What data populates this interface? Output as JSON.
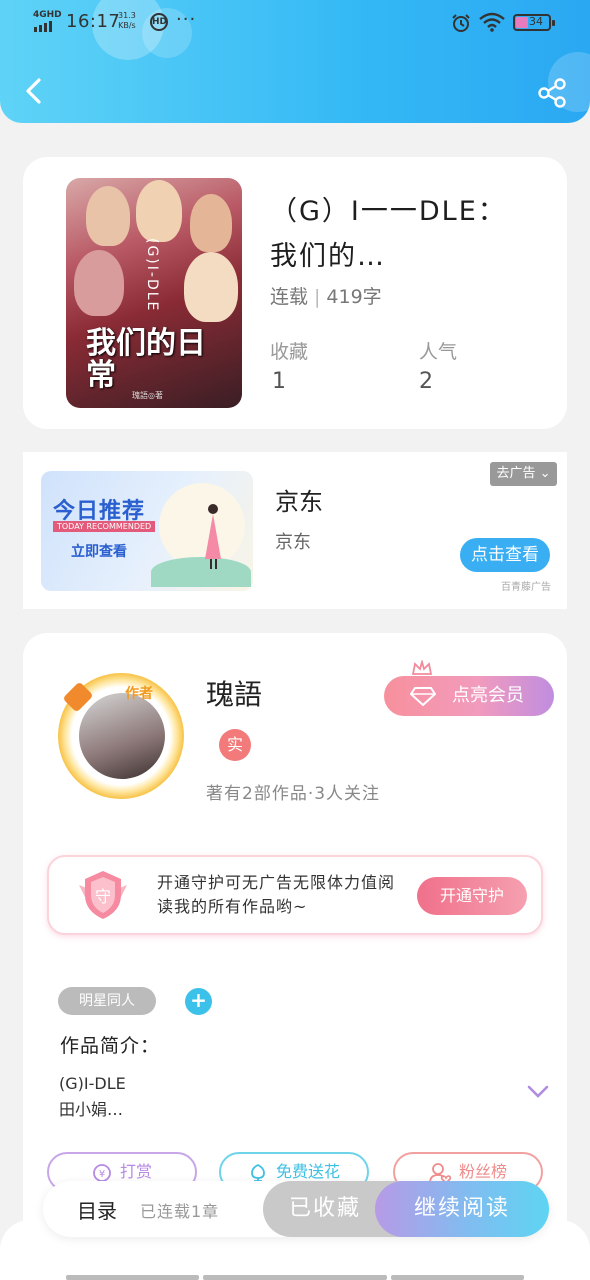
{
  "status_bar": {
    "network": "4GHD",
    "time": "16:17",
    "speed_value": "31.3",
    "speed_unit": "KB/s",
    "hd_badge": "HD",
    "dots": "···",
    "battery": "34"
  },
  "header": {
    "back_icon": "chevron-left-icon",
    "share_icon": "share-icon"
  },
  "book": {
    "cover_title": "我们的日常",
    "cover_subtitle": "(G)I-DLE",
    "cover_author": "瑰語◎著",
    "title": "（G）I一一DLE：我们的…",
    "status": "连载",
    "word_count": "419字",
    "favorites_label": "收藏",
    "favorites_value": "1",
    "popularity_label": "人气",
    "popularity_value": "2"
  },
  "ad": {
    "image_title": "今日推荐",
    "image_subtitle": "TODAY RECOMMENDED",
    "image_cta": "立即查看",
    "title": "京东",
    "description": "京东",
    "close_label": "去广告",
    "cta_label": "点击查看",
    "source": "百青藤广告"
  },
  "author": {
    "tag": "作者",
    "name": "瑰語",
    "real_badge": "实",
    "stats": "著有2部作品·3人关注",
    "vip_label": "点亮会员",
    "guard_badge": "守",
    "guard_text": "开通守护可无广告无限体力值阅读我的所有作品哟~",
    "guard_button": "开通守护",
    "category_tag": "明星同人",
    "add_tag": "+",
    "intro_label": "作品简介：",
    "intro_line1": "(G)I-DLE",
    "intro_line2": "田小娟…",
    "actions": {
      "tip": "打赏",
      "flower": "免费送花",
      "fans": "粉丝榜"
    }
  },
  "bottom_bar": {
    "toc_label": "目录",
    "toc_count": "已连载1章",
    "collected_label": "已收藏",
    "read_label": "继续阅读"
  },
  "colors": {
    "header_accent": "#35b9f5",
    "vip_pink": "#f7909c",
    "guard_pink": "#f0708a",
    "tag_blue": "#3cc2ea"
  }
}
